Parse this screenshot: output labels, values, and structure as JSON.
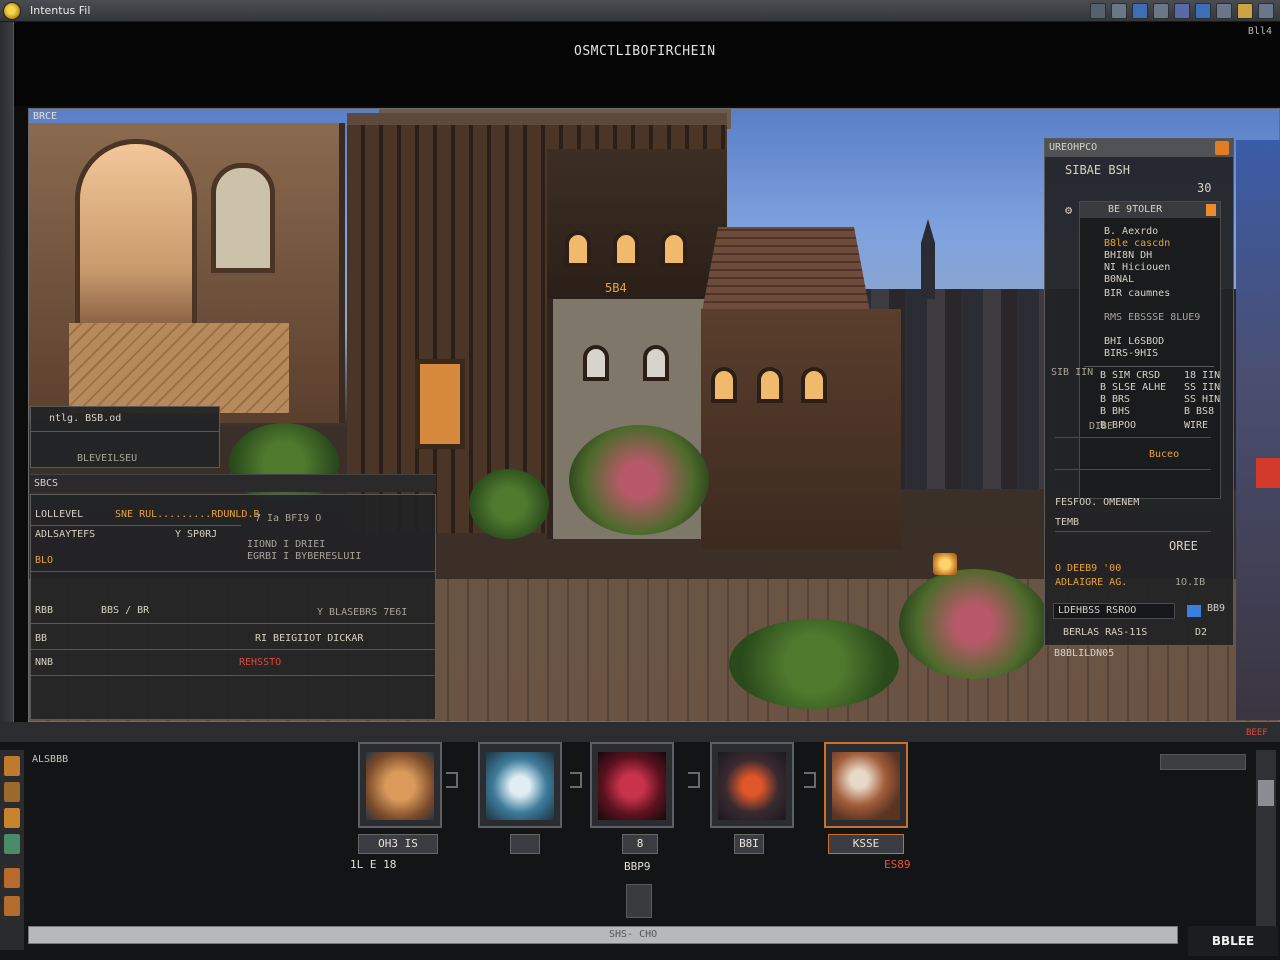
{
  "window": {
    "title": "Intentus Fil",
    "topright": "Bll4",
    "header_title": "OSMCTLIBOFIRCHEIN"
  },
  "viewport": {
    "label": "BRCE",
    "sign": "5B4"
  },
  "left_panel": {
    "top_caption": "ntlg. BSB.od",
    "top_sub": "BLEVEILSEU",
    "status_left": "SBCS",
    "row1_label": "LOLLEVEL",
    "row1_value": "SNE RUL.........RDUNLD.B",
    "row1_right": "7 Ia BFI9 O",
    "row2_label": "ADLSAYTEFS",
    "row2_value": "Y SP0RJ",
    "row2_right_a": "IIOND I DRIEI",
    "row2_right_b": "EGRBI I BYBERESLUII",
    "row3_label": "BLO",
    "row4_label": "RBB",
    "row4_value": "BBS / BR",
    "row4_right": "Y BLASEBRS 7E6I",
    "row5_label": "BB",
    "row5_value": "RI BEIGIIOT DICKAR",
    "row6_label": "NNB",
    "row6_value": "REHSSTO"
  },
  "right_panel": {
    "header": "UREOHPCO",
    "title": "SIBAE BSH",
    "count": "30",
    "sub_header": "BE 9TOLER",
    "list": [
      "B. Aexrdo",
      "B8le cascdn",
      "BHI8N DH",
      "NI Hiciouen",
      "B0NAL",
      "BIR caumnes",
      "RMS EBSSSE 8LUE9",
      "BHI L6SBOD",
      "BIRS-9HIS"
    ],
    "table": [
      {
        "label": "B",
        "value": "SIM CRSD",
        "stat": "18 IIN"
      },
      {
        "label": "B",
        "value": "SLSE ALHE",
        "stat": "SS IIN"
      },
      {
        "label": "B",
        "value": "BRS",
        "stat": "SS HIN"
      },
      {
        "label": "B",
        "value": "BHS",
        "stat": "B BS8"
      },
      {
        "label": "B",
        "value": "BPOO",
        "stat": "WIRE"
      }
    ],
    "side_label": "SIB IIN",
    "side_label2": "DIBE",
    "action": "Buceo",
    "field_label": "FESFOO. OMENEM",
    "field_sub": "TEMB",
    "field_right": "OREE",
    "note_a": "O DEEB9 '00",
    "note_b": "ADLAIGRE AG.",
    "note_b_right": "1O.IB",
    "input_label": "LDEHBSS RSROO",
    "input_right": "BB9",
    "footer": "BERLAS RAS-11S",
    "footer_right": "D2",
    "footer2": "B8BLILDN05"
  },
  "tray": {
    "label": "ALSBBB",
    "cards": [
      {
        "label": "OH3 IS"
      },
      {
        "label": ""
      },
      {
        "label": "8"
      },
      {
        "label": "B8I"
      },
      {
        "label": "KSSE"
      }
    ],
    "num_left": "1L E 18",
    "num_mid_a": "BBP9",
    "num_right": "ES89",
    "scroll_text": "SHS- CHO",
    "badge": "BBLEE",
    "red_corner": "BEEF"
  }
}
